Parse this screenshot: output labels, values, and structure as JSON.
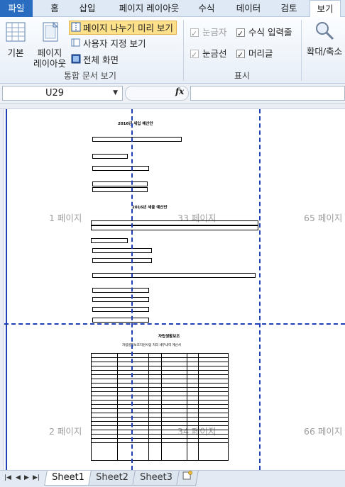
{
  "ribbon": {
    "tabs": [
      "파일",
      "홈",
      "삽입",
      "페이지 레이아웃",
      "수식",
      "데이터",
      "검토",
      "보기"
    ],
    "active_tab": "보기",
    "workbook_views": {
      "normal": "기본",
      "page_layout_l1": "페이지",
      "page_layout_l2": "레이아웃",
      "page_break_preview": "페이지 나누기 미리 보기",
      "custom_views": "사용자 지정 보기",
      "full_screen": "전체 화면",
      "group_label": "통합 문서 보기"
    },
    "show": {
      "ruler": "눈금자",
      "gridlines": "눈금선",
      "formula_bar": "수식 입력줄",
      "headings": "머리글",
      "group_label": "표시"
    },
    "zoom": {
      "label": "확대/축소"
    }
  },
  "formula_bar": {
    "name_box": "U29",
    "fx": "fx",
    "content": ""
  },
  "sheet": {
    "page_watermarks": [
      "1 페이지",
      "33 페이지",
      "65 페이지",
      "2 페이지",
      "34 페이지",
      "66 페이지"
    ],
    "content": {
      "title1": "2016년 세입 예산안",
      "title2": "2016년 세출 예산안",
      "title3": "자립생활보조",
      "subtitle3": "자립생활보조지원사업 처리 세부내역 계산서"
    }
  },
  "sheet_tabs": [
    "Sheet1",
    "Sheet2",
    "Sheet3"
  ],
  "active_sheet": "Sheet1",
  "colors": {
    "page_break": "#1f3fb5",
    "file_tab": "#2a6cbf",
    "highlight": "#fde08a"
  }
}
